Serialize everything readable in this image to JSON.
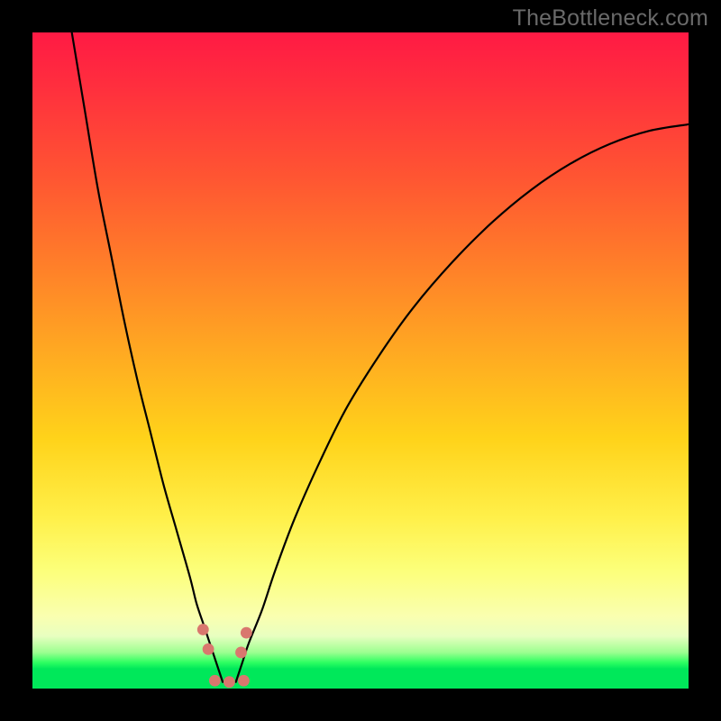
{
  "watermark": "TheBottleneck.com",
  "colors": {
    "frame": "#000000",
    "gradient_top": "#ff1a44",
    "gradient_mid": "#ffd31a",
    "gradient_bottom_band": "#00e85a",
    "curve": "#000000",
    "marker": "#d9776e"
  },
  "chart_data": {
    "type": "line",
    "title": "",
    "xlabel": "",
    "ylabel": "",
    "xlim": [
      0,
      100
    ],
    "ylim": [
      0,
      100
    ],
    "grid": false,
    "legend": false,
    "annotations": [],
    "series": [
      {
        "name": "left-curve",
        "x": [
          6,
          8,
          10,
          12,
          14,
          16,
          18,
          20,
          22,
          24,
          25,
          26,
          27,
          28,
          29
        ],
        "values": [
          100,
          88,
          76,
          66,
          56,
          47,
          39,
          31,
          24,
          17,
          13,
          10,
          7,
          4,
          1
        ]
      },
      {
        "name": "right-curve",
        "x": [
          31,
          32,
          33,
          35,
          37,
          40,
          44,
          48,
          53,
          58,
          64,
          70,
          76,
          82,
          88,
          94,
          100
        ],
        "values": [
          1,
          4,
          7,
          12,
          18,
          26,
          35,
          43,
          51,
          58,
          65,
          71,
          76,
          80,
          83,
          85,
          86
        ]
      }
    ],
    "markers": [
      {
        "name": "marker-left-upper",
        "x": 26.0,
        "y": 9.0,
        "r": 1.6
      },
      {
        "name": "marker-left-lower",
        "x": 26.8,
        "y": 6.0,
        "r": 1.6
      },
      {
        "name": "marker-right-upper",
        "x": 32.6,
        "y": 8.5,
        "r": 1.6
      },
      {
        "name": "marker-right-lower",
        "x": 31.8,
        "y": 5.5,
        "r": 1.6
      },
      {
        "name": "marker-bottom-left",
        "x": 27.8,
        "y": 1.2,
        "r": 1.6
      },
      {
        "name": "marker-bottom-mid",
        "x": 30.0,
        "y": 1.0,
        "r": 1.6
      },
      {
        "name": "marker-bottom-right",
        "x": 32.2,
        "y": 1.2,
        "r": 1.6
      }
    ]
  }
}
